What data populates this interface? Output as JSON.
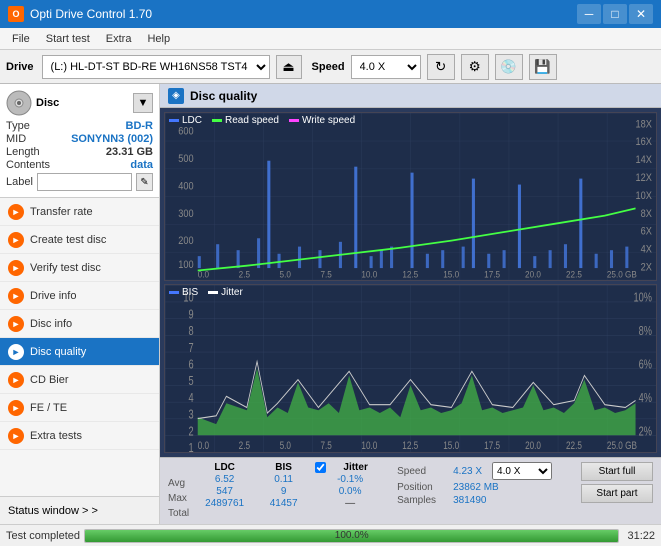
{
  "titlebar": {
    "title": "Opti Drive Control 1.70",
    "icon_label": "O",
    "minimize": "─",
    "maximize": "□",
    "close": "✕"
  },
  "menubar": {
    "items": [
      "File",
      "Start test",
      "Extra",
      "Help"
    ]
  },
  "drivebar": {
    "label": "Drive",
    "drive_value": "(L:)  HL-DT-ST BD-RE  WH16NS58 TST4",
    "speed_label": "Speed",
    "speed_value": "4.0 X"
  },
  "disc": {
    "header": "Disc",
    "type_label": "Type",
    "type_value": "BD-R",
    "mid_label": "MID",
    "mid_value": "SONYNN3 (002)",
    "length_label": "Length",
    "length_value": "23.31 GB",
    "contents_label": "Contents",
    "contents_value": "data",
    "label_label": "Label",
    "label_value": ""
  },
  "sidebar": {
    "items": [
      {
        "id": "transfer-rate",
        "label": "Transfer rate",
        "icon": "►"
      },
      {
        "id": "create-test-disc",
        "label": "Create test disc",
        "icon": "►"
      },
      {
        "id": "verify-test-disc",
        "label": "Verify test disc",
        "icon": "►"
      },
      {
        "id": "drive-info",
        "label": "Drive info",
        "icon": "►"
      },
      {
        "id": "disc-info",
        "label": "Disc info",
        "icon": "►"
      },
      {
        "id": "disc-quality",
        "label": "Disc quality",
        "icon": "►",
        "active": true
      },
      {
        "id": "cd-bier",
        "label": "CD Bier",
        "icon": "►"
      },
      {
        "id": "fe-te",
        "label": "FE / TE",
        "icon": "►"
      },
      {
        "id": "extra-tests",
        "label": "Extra tests",
        "icon": "►"
      }
    ],
    "status_window": "Status window > >"
  },
  "disc_quality": {
    "title": "Disc quality",
    "chart1": {
      "legend": [
        {
          "id": "ldc",
          "label": "LDC"
        },
        {
          "id": "read",
          "label": "Read speed"
        },
        {
          "id": "write",
          "label": "Write speed"
        }
      ],
      "y_max": 600,
      "y_labels_left": [
        "600",
        "500",
        "400",
        "300",
        "200",
        "100"
      ],
      "y_labels_right": [
        "18X",
        "16X",
        "14X",
        "12X",
        "10X",
        "8X",
        "6X",
        "4X",
        "2X"
      ],
      "x_labels": [
        "0.0",
        "2.5",
        "5.0",
        "7.5",
        "10.0",
        "12.5",
        "15.0",
        "17.5",
        "20.0",
        "22.5",
        "25.0 GB"
      ]
    },
    "chart2": {
      "legend": [
        {
          "id": "bis",
          "label": "BIS"
        },
        {
          "id": "jitter",
          "label": "Jitter"
        }
      ],
      "y_max": 10,
      "y_labels_left": [
        "10",
        "9",
        "8",
        "7",
        "6",
        "5",
        "4",
        "3",
        "2",
        "1"
      ],
      "y_labels_right": [
        "10%",
        "8%",
        "6%",
        "4%",
        "2%"
      ],
      "x_labels": [
        "0.0",
        "2.5",
        "5.0",
        "7.5",
        "10.0",
        "12.5",
        "15.0",
        "17.5",
        "20.0",
        "22.5",
        "25.0 GB"
      ]
    }
  },
  "stats": {
    "headers": [
      "LDC",
      "BIS",
      "",
      "Jitter",
      "Speed",
      ""
    ],
    "jitter_checked": true,
    "jitter_label": "Jitter",
    "speed_label": "Speed",
    "speed_value": "4.23 X",
    "speed_select": "4.0 X",
    "avg_ldc": "6.52",
    "avg_bis": "0.11",
    "avg_jitter": "-0.1%",
    "max_ldc": "547",
    "max_bis": "9",
    "max_jitter": "0.0%",
    "total_ldc": "2489761",
    "total_bis": "41457",
    "rows": [
      "Avg",
      "Max",
      "Total"
    ],
    "position_label": "Position",
    "position_value": "23862 MB",
    "samples_label": "Samples",
    "samples_value": "381490",
    "start_full": "Start full",
    "start_part": "Start part"
  },
  "statusbar": {
    "status_text": "Test completed",
    "progress": "100.0%",
    "time": "31:22"
  }
}
